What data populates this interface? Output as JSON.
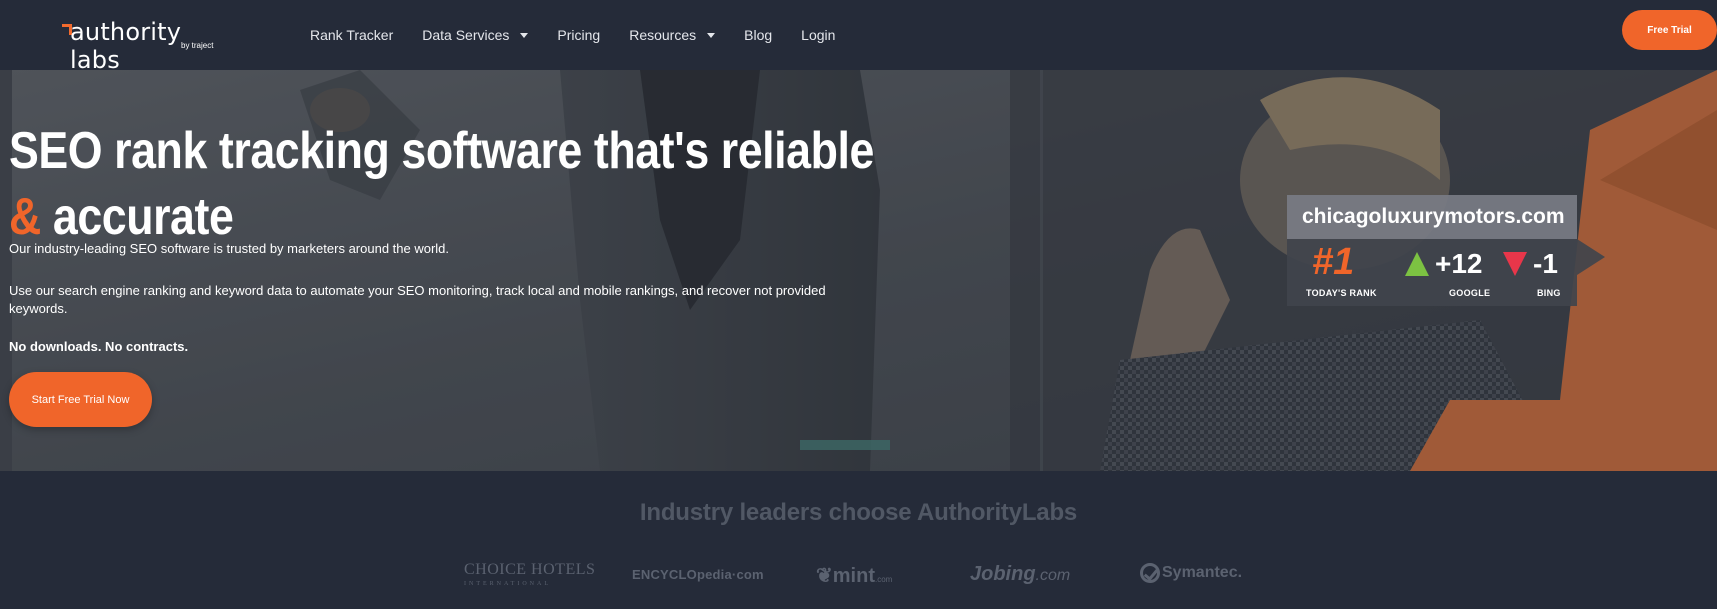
{
  "brand": {
    "name": "authority labs",
    "sub": "by traject",
    "accent": "#f0652a",
    "nav_bg": "#252b39"
  },
  "nav": {
    "items": [
      {
        "label": "Rank Tracker"
      },
      {
        "label": "Data Services",
        "dropdown": true
      },
      {
        "label": "Pricing"
      },
      {
        "label": "Resources",
        "dropdown": true
      },
      {
        "label": "Blog"
      },
      {
        "label": "Login"
      }
    ],
    "cta": "Free Trial"
  },
  "hero": {
    "title_line1": "SEO rank tracking software that's reliable",
    "title_amp": "&",
    "title_line2": "accurate",
    "p1": "Our industry-leading SEO software is trusted by marketers around the world.",
    "p2": "Use our search engine ranking and keyword data to automate your SEO monitoring, track local and mobile rankings, and recover not provided keywords.",
    "p3": "No downloads. No contracts.",
    "cta": "Start Free Trial Now"
  },
  "rank_card": {
    "domain": "chicagoluxurymotors.com",
    "rank": "#1",
    "rank_label": "TODAY'S RANK",
    "google_delta": "+12",
    "google_label": "GOOGLE",
    "bing_delta": "-1",
    "bing_label": "BING",
    "up_color": "#7cc242",
    "down_color": "#e8364a"
  },
  "clients": {
    "title": "Industry leaders choose AuthorityLabs",
    "logos": {
      "choice_main": "CHOICE HOTELS",
      "choice_sub": "INTERNATIONAL",
      "encyclopedia": "ENCYCLOpedia·com",
      "mint": "mint",
      "mint_suffix": ".com",
      "jobing": "Jobing",
      "jobing_suffix": ".com",
      "symantec": "Symantec."
    }
  }
}
